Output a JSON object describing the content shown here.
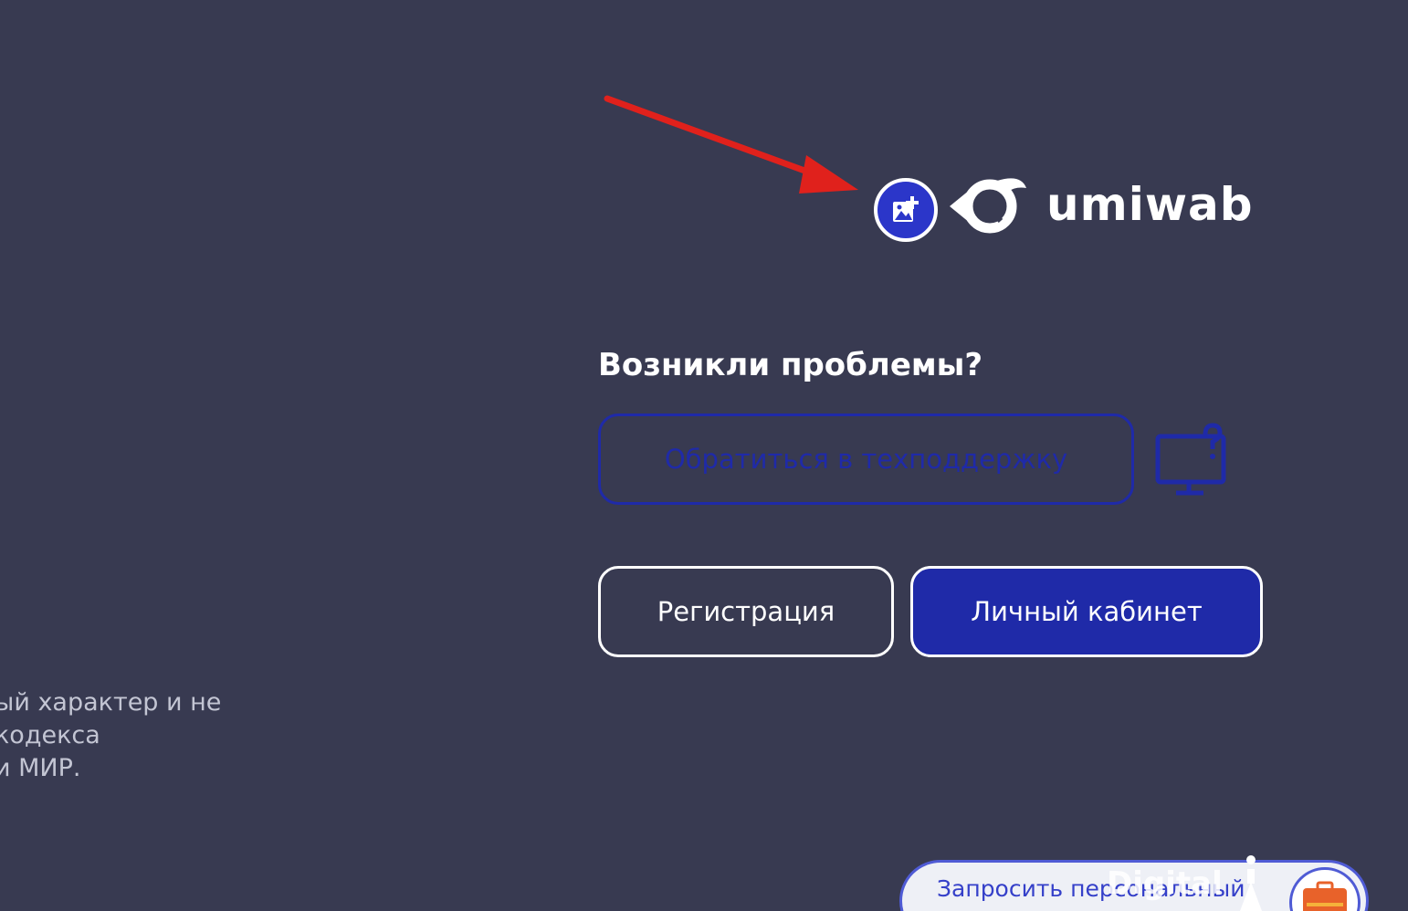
{
  "logo": {
    "text": "umiwab"
  },
  "problems": {
    "title": "Возникли проблемы?",
    "support_label": "Обратиться в техподдержку"
  },
  "actions": {
    "register_label": "Регистрация",
    "cabinet_label": "Личный кабинет"
  },
  "disclaimer": {
    "lines": [
      "ый характер и не",
      "кодекса",
      "и МИР."
    ]
  },
  "widget": {
    "request_text": "Запросить персональный",
    "overlay_text": "Digital"
  },
  "colors": {
    "background": "#383a51",
    "accent": "#1f2aa8",
    "annotation_arrow": "#e0211c"
  }
}
